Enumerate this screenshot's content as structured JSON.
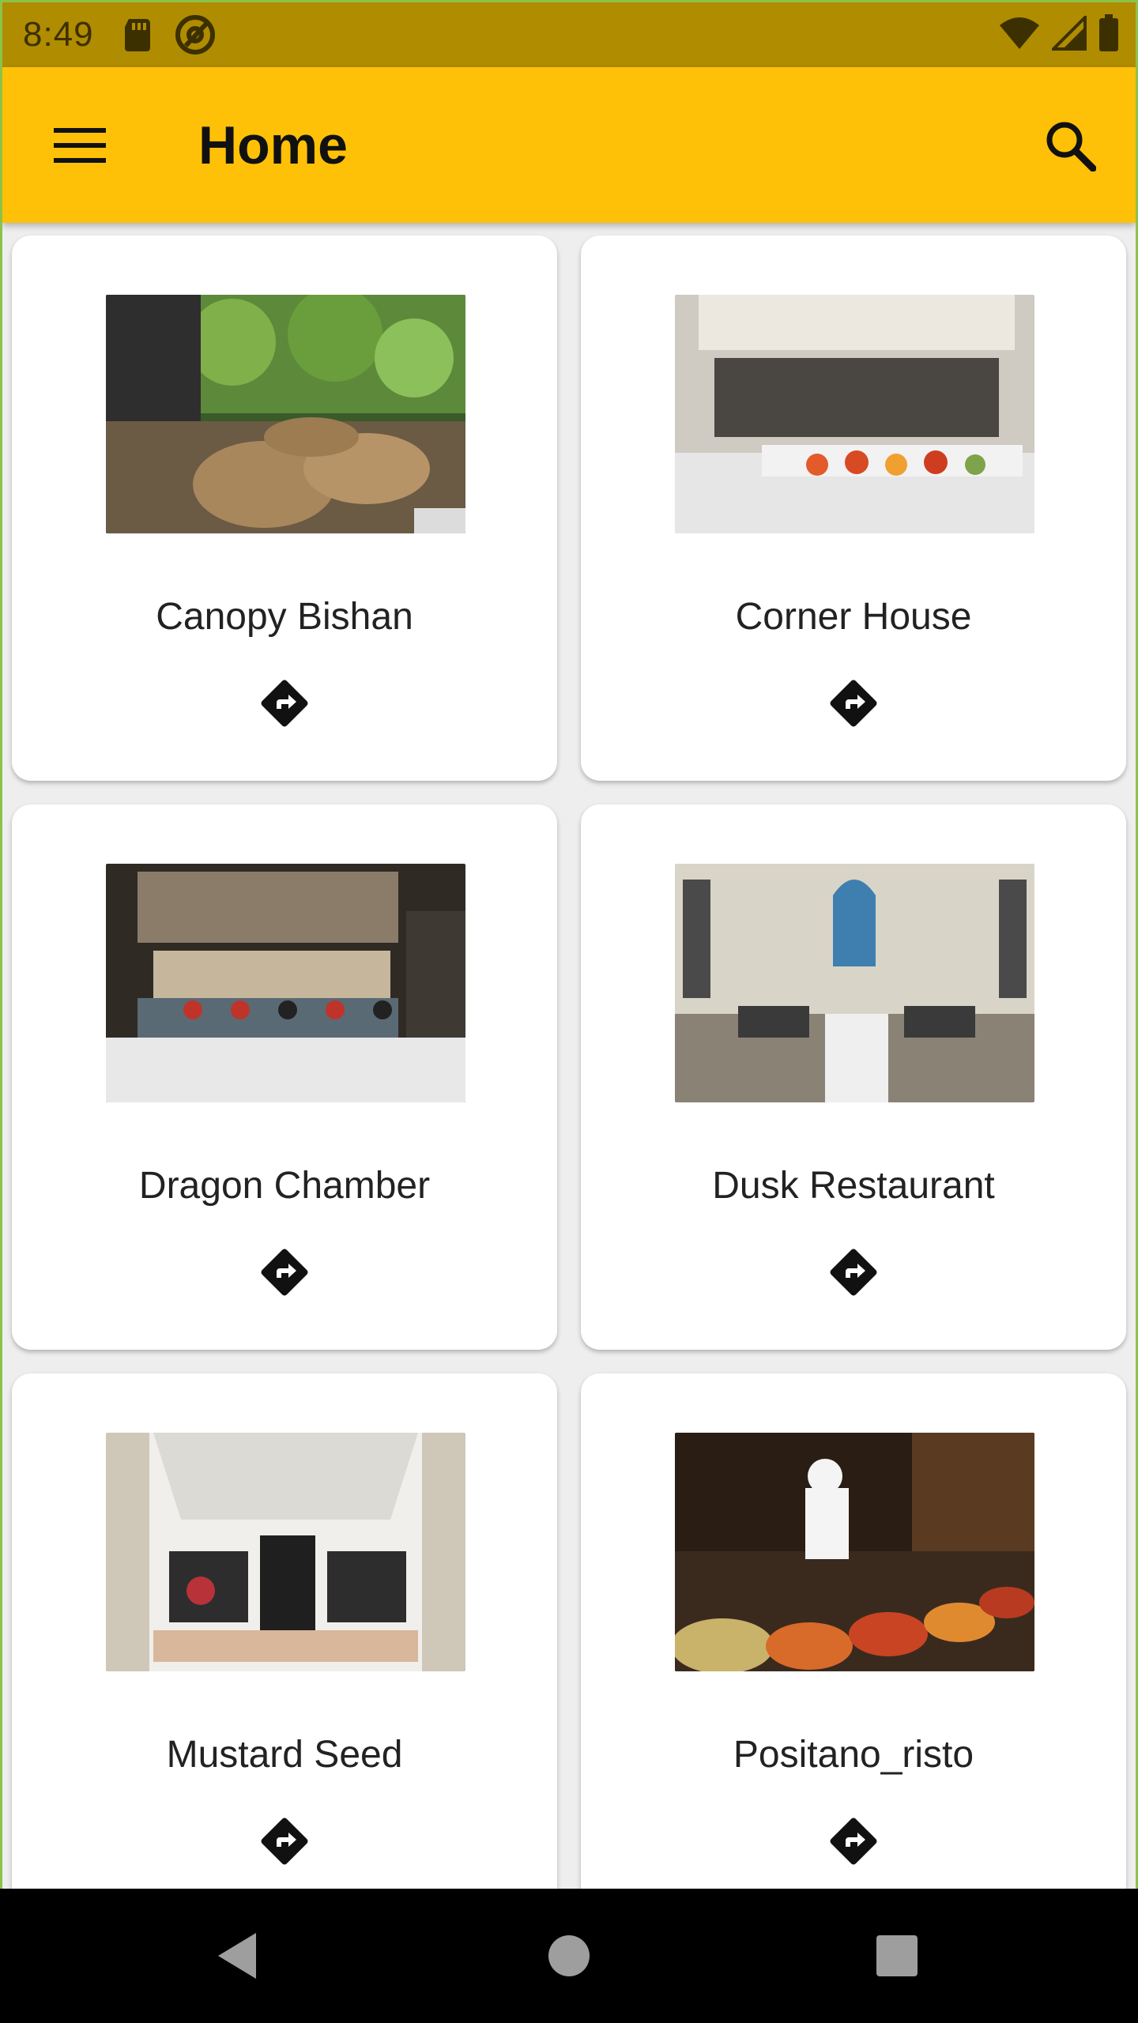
{
  "status_bar": {
    "time": "8:49",
    "icons_left": [
      "sd-card-icon",
      "at-sign-icon"
    ],
    "icons_right": [
      "wifi-icon",
      "signal-icon",
      "battery-icon"
    ]
  },
  "app_bar": {
    "title": "Home",
    "background": "#ffc107",
    "menu_icon": "hamburger-menu-icon",
    "search_icon": "search-icon"
  },
  "restaurants": [
    {
      "name": "Canopy Bishan",
      "image": "garden-terrace-dining-image"
    },
    {
      "name": "Corner House",
      "image": "buffet-kitchen-image"
    },
    {
      "name": "Dragon Chamber",
      "image": "bar-interior-image"
    },
    {
      "name": "Dusk Restaurant",
      "image": "chapel-dining-hall-image"
    },
    {
      "name": "Mustard Seed",
      "image": "food-hall-image"
    },
    {
      "name": "Positano_risto",
      "image": "chef-cooking-image"
    }
  ],
  "nav_bar": {
    "back": "back-triangle-icon",
    "home": "home-circle-icon",
    "recents": "recents-square-icon"
  }
}
